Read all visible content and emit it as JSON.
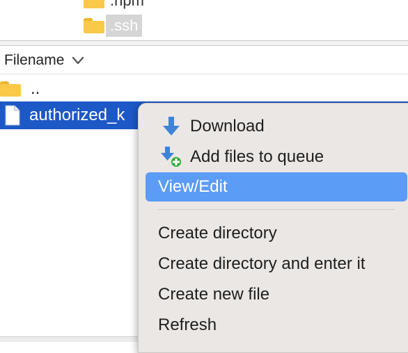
{
  "tree": {
    "items": [
      {
        "label": ".npm"
      },
      {
        "label": ".ssh"
      }
    ]
  },
  "file_list": {
    "column_header": "Filename",
    "rows": [
      {
        "name": ".."
      },
      {
        "name": "authorized_k"
      }
    ]
  },
  "context_menu": {
    "items": [
      {
        "label": "Download",
        "icon": "download-arrow-icon"
      },
      {
        "label": "Add files to queue",
        "icon": "add-to-queue-icon"
      },
      {
        "label": "View/Edit"
      },
      {
        "label": "Create directory"
      },
      {
        "label": "Create directory and enter it"
      },
      {
        "label": "Create new file"
      },
      {
        "label": "Refresh"
      }
    ],
    "highlighted": "View/Edit"
  },
  "colors": {
    "selection_row": "#1d58c7",
    "menu_highlight": "#5b9cf6",
    "menu_background": "#ebe7e4",
    "folder": "#fbc948"
  }
}
